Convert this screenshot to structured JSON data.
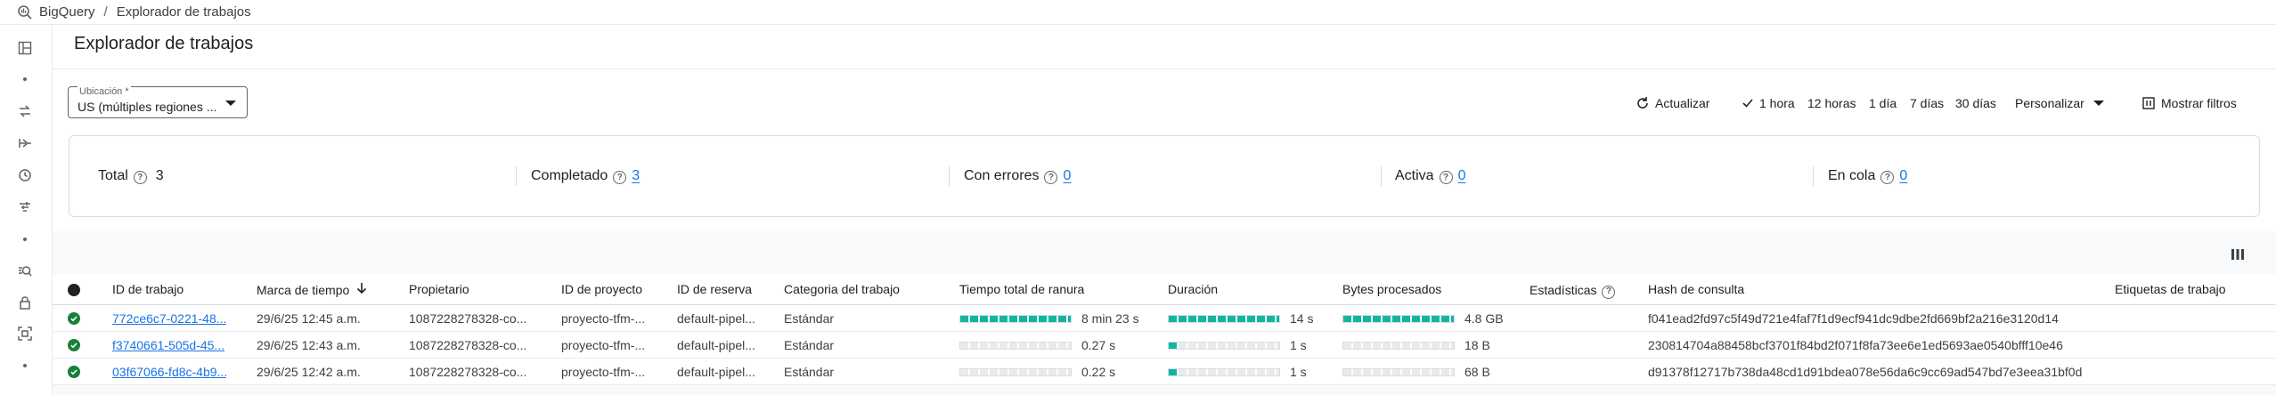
{
  "breadcrumb": {
    "app": "BigQuery",
    "separator": "/",
    "page": "Explorador de trabajos"
  },
  "page_title": "Explorador de trabajos",
  "location": {
    "label": "Ubicación *",
    "value": "US (múltiples regiones ..."
  },
  "toolbar": {
    "refresh": "Actualizar",
    "ranges": [
      "1 hora",
      "12 horas",
      "1 día",
      "7 días",
      "30 días"
    ],
    "selected_range": "1 hora",
    "custom": "Personalizar",
    "filters": "Mostrar filtros"
  },
  "summary": {
    "total": {
      "label": "Total",
      "count": "3"
    },
    "completed": {
      "label": "Completado",
      "count": "3"
    },
    "errors": {
      "label": "Con errores",
      "count": "0"
    },
    "active": {
      "label": "Activa",
      "count": "0"
    },
    "queued": {
      "label": "En cola",
      "count": "0"
    }
  },
  "table": {
    "headers": {
      "job_id": "ID de trabajo",
      "timestamp": "Marca de tiempo",
      "owner": "Propietario",
      "project": "ID de proyecto",
      "reservation": "ID de reserva",
      "category": "Categoria del trabajo",
      "slot_time": "Tiempo total de ranura",
      "duration": "Duración",
      "bytes": "Bytes procesados",
      "stats": "Estadísticas",
      "hash": "Hash de consulta",
      "labels": "Etiquetas de trabajo"
    },
    "rows": [
      {
        "status": "success",
        "job_id": "772ce6c7-0221-48...",
        "timestamp": "29/6/25 12:45 a.m.",
        "owner": "1087228278328-co...",
        "project": "proyecto-tfm-...",
        "reservation": "default-pipel...",
        "category": "Estándar",
        "slot_time": "8 min 23 s",
        "slot_level": 1.0,
        "duration": "14 s",
        "duration_level": 1.0,
        "bytes": "4.8 GB",
        "bytes_level": 1.0,
        "hash": "f041ead2fd97c5f49d721e4faf7f1d9ecf941dc9dbe2fd669bf2a216e3120d14"
      },
      {
        "status": "success",
        "job_id": "f3740661-505d-45...",
        "timestamp": "29/6/25 12:43 a.m.",
        "owner": "1087228278328-co...",
        "project": "proyecto-tfm-...",
        "reservation": "default-pipel...",
        "category": "Estándar",
        "slot_time": "0.27 s",
        "slot_level": 0.0,
        "duration": "1 s",
        "duration_level": 0.08,
        "bytes": "18 B",
        "bytes_level": 0.0,
        "hash": "230814704a88458bcf3701f84bd2f071f8fa73ee6e1ed5693ae0540bfff10e46"
      },
      {
        "status": "success",
        "job_id": "03f67066-fd8c-4b9...",
        "timestamp": "29/6/25 12:42 a.m.",
        "owner": "1087228278328-co...",
        "project": "proyecto-tfm-...",
        "reservation": "default-pipel...",
        "category": "Estándar",
        "slot_time": "0.22 s",
        "slot_level": 0.0,
        "duration": "1 s",
        "duration_level": 0.08,
        "bytes": "68 B",
        "bytes_level": 0.0,
        "hash": "d91378f12717b738da48cd1d91bdea078e56da6c9cc69ad547bd7e3eea31bf0d"
      }
    ]
  },
  "colors": {
    "accent": "#1a73e8",
    "success": "#188038",
    "bar": "#12b5a4"
  },
  "icons": {
    "rail": [
      "panel-icon",
      "dot-icon",
      "transfer-icon",
      "pipeline-icon",
      "history-icon",
      "filter-list-icon",
      "dot-icon",
      "search-analyze-icon",
      "lock-icon",
      "focus-icon",
      "dot-icon"
    ]
  }
}
